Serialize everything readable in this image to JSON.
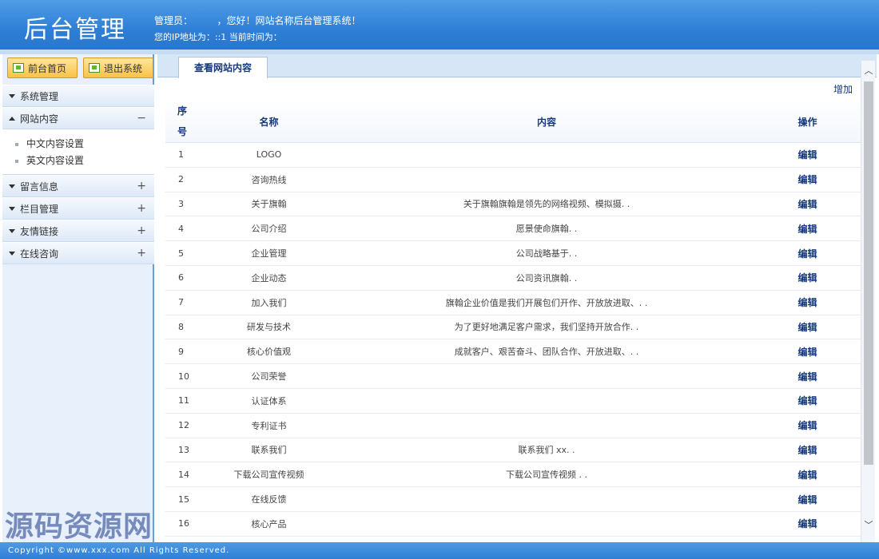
{
  "header": {
    "title": "后台管理",
    "line1": "管理员：        ，您好！网站名称后台管理系统！",
    "line2": "您的IP地址为：::1 当前时间为："
  },
  "sidebar": {
    "home_button": "前台首页",
    "exit_button": "退出系统",
    "menu": [
      {
        "label": "系统管理"
      },
      {
        "label": "网站内容",
        "toggle": "−"
      },
      {
        "label": "留言信息",
        "toggle": "+"
      },
      {
        "label": "栏目管理",
        "toggle": "+"
      },
      {
        "label": "友情链接",
        "toggle": "+"
      },
      {
        "label": "在线咨询",
        "toggle": "+"
      }
    ],
    "sub_items": [
      "中文内容设置",
      "英文内容设置"
    ]
  },
  "main": {
    "tab": "查看网站内容",
    "add": "增加",
    "headers": {
      "no": "序号",
      "name": "名称",
      "content": "内容",
      "op": "操作"
    },
    "rows": [
      {
        "no": "1",
        "name": "LOGO",
        "content": "",
        "op": "编辑"
      },
      {
        "no": "2",
        "name": "咨询热线",
        "content": "",
        "op": "编辑"
      },
      {
        "no": "3",
        "name": "关于旗翰",
        "content": "关于旗翰旗翰是领先的网络视频、模拟摄. .",
        "op": "编辑"
      },
      {
        "no": "4",
        "name": "公司介绍",
        "content": "愿景使命旗翰. .",
        "op": "编辑"
      },
      {
        "no": "5",
        "name": "企业管理",
        "content": "公司战略基于. .",
        "op": "编辑"
      },
      {
        "no": "6",
        "name": "企业动态",
        "content": "公司资讯旗翰. .",
        "op": "编辑"
      },
      {
        "no": "7",
        "name": "加入我们",
        "content": "旗翰企业价值是我们开展包们开作、开放放进取、. .",
        "op": "编辑"
      },
      {
        "no": "8",
        "name": "研发与技术",
        "content": "为了更好地满足客户需求，我们坚持开放合作. .",
        "op": "编辑"
      },
      {
        "no": "9",
        "name": "核心价值观",
        "content": "成就客户、艰苦奋斗、团队合作、开放进取、. .",
        "op": "编辑"
      },
      {
        "no": "10",
        "name": "公司荣誉",
        "content": "",
        "op": "编辑"
      },
      {
        "no": "11",
        "name": "认证体系",
        "content": "",
        "op": "编辑"
      },
      {
        "no": "12",
        "name": "专利证书",
        "content": "",
        "op": "编辑"
      },
      {
        "no": "13",
        "name": "联系我们",
        "content": "联系我们 xx. .",
        "op": "编辑"
      },
      {
        "no": "14",
        "name": "下载公司宣传视频",
        "content": "下载公司宣传视频 . .",
        "op": "编辑"
      },
      {
        "no": "15",
        "name": "在线反馈",
        "content": "",
        "op": "编辑"
      },
      {
        "no": "16",
        "name": "核心产品",
        "content": "",
        "op": "编辑"
      }
    ]
  },
  "footer": {
    "text": "Copyright ©www.xxx.com All Rights Reserved."
  },
  "watermark": "源码资源网"
}
